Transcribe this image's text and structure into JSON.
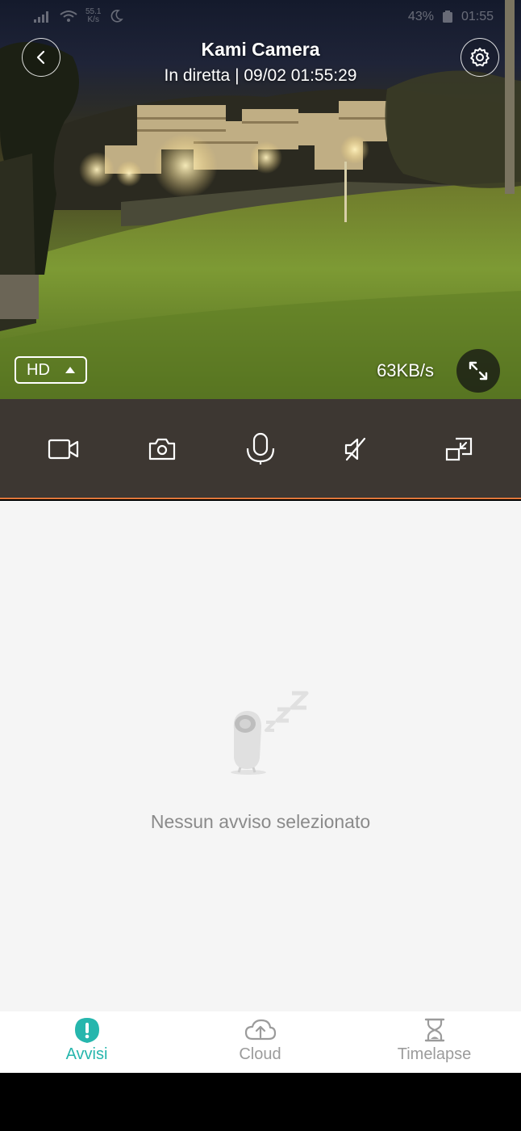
{
  "status_bar": {
    "network_speed_value": "55.1",
    "network_speed_unit": "K/s",
    "battery": "43%",
    "time": "01:55"
  },
  "header": {
    "title": "Kami Camera",
    "subtitle": "In diretta | 09/02 01:55:29"
  },
  "live_view": {
    "quality_label": "HD",
    "bitrate": "63KB/s"
  },
  "controls": [
    {
      "icon": "video-record-icon"
    },
    {
      "icon": "snapshot-camera-icon"
    },
    {
      "icon": "microphone-icon"
    },
    {
      "icon": "speaker-muted-icon"
    },
    {
      "icon": "minimize-window-icon"
    }
  ],
  "alerts": {
    "empty_message": "Nessun avviso selezionato"
  },
  "tabs": [
    {
      "label": "Avvisi",
      "icon": "alert-icon",
      "active": true
    },
    {
      "label": "Cloud",
      "icon": "cloud-upload-icon",
      "active": false
    },
    {
      "label": "Timelapse",
      "icon": "hourglass-icon",
      "active": false
    }
  ],
  "colors": {
    "accent": "#26b6ad",
    "control_bar": "#3d3732",
    "control_bar_border": "#e0763a",
    "content_bg": "#f5f5f5",
    "inactive_tab": "#9b9b9b"
  }
}
